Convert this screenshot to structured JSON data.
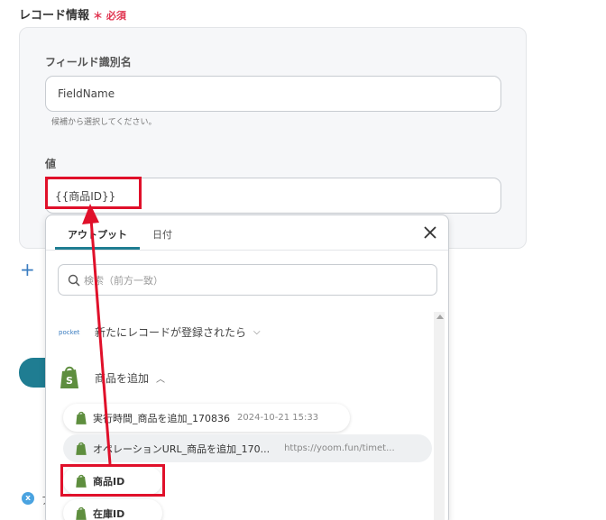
{
  "section": {
    "title": "レコード情報",
    "required_label": "＊ 必須"
  },
  "field_name": {
    "label": "フィールド識別名",
    "value": "FieldName",
    "hint": "候補から選択してください。"
  },
  "value_field": {
    "label": "値",
    "value": "{{商品ID}}"
  },
  "dropdown": {
    "tabs": [
      {
        "label": "アウトプット",
        "active": true
      },
      {
        "label": "日付",
        "active": false
      }
    ],
    "close_icon": "close-icon",
    "search_placeholder": "検索（前方一致）",
    "groups": [
      {
        "app_label": "pocket",
        "label": "新たにレコードが登録されたら",
        "expanded": false
      },
      {
        "label": "商品を追加",
        "expanded": true
      }
    ],
    "items": [
      {
        "label": "実行時間_商品を追加_170836",
        "value": "2024-10-21 15:33"
      },
      {
        "label": "オペレーションURL_商品を追加_170...",
        "value": "https://yoom.fun/timet..."
      },
      {
        "label": "商品ID"
      },
      {
        "label": "在庫ID"
      }
    ]
  },
  "misc": {
    "x_badge": "x",
    "x_badge_text": "ア"
  },
  "colors": {
    "accent": "#1f7d92",
    "required": "#e0334f",
    "annotation_red": "#e0102a",
    "shopify_green": "#5e8e3e"
  }
}
